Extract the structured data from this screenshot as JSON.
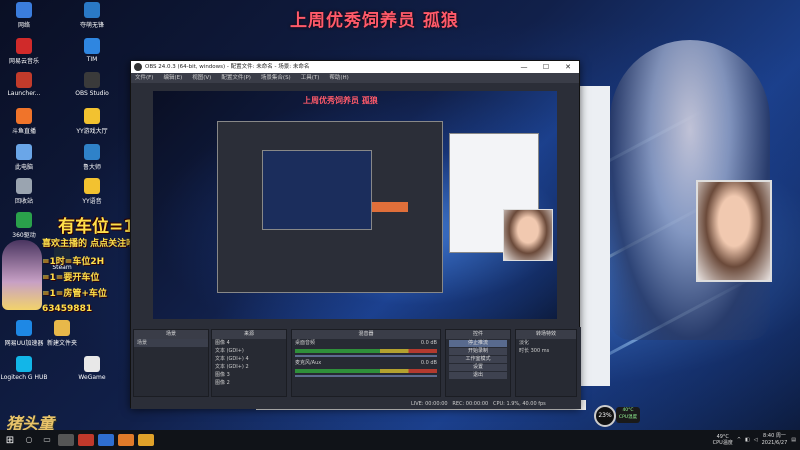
{
  "stream": {
    "title": "上周优秀饲养员 孤狼",
    "overlay_big": "有车位=1",
    "overlay_lines": [
      "喜欢主播的 点点关注哈",
      "=1时=车位2H",
      "=1=要开车位",
      "=1=房管+车位",
      "63459881"
    ]
  },
  "desktop_icons": [
    {
      "label": "网络",
      "color": "#3b7ddd"
    },
    {
      "label": "夺萌无锋",
      "color": "#2a79c6"
    },
    {
      "label": "网易云音乐",
      "color": "#d02a2a"
    },
    {
      "label": "TIM",
      "color": "#2f86e0"
    },
    {
      "label": "Launcher...",
      "color": "#c23b2b"
    },
    {
      "label": "OBS Studio",
      "color": "#3a3a3a"
    },
    {
      "label": "斗鱼直播",
      "color": "#f0742a"
    },
    {
      "label": "YY游戏大厅",
      "color": "#f2c230"
    },
    {
      "label": "此电脑",
      "color": "#6aa6e8"
    },
    {
      "label": "鲁大师",
      "color": "#2f82c9"
    },
    {
      "label": "回收站",
      "color": "#9aa4b0"
    },
    {
      "label": "YY语音",
      "color": "#f2c230"
    },
    {
      "label": "360驱动",
      "color": "#2aa14b"
    },
    {
      "label": "Steam",
      "color": "#1b2838"
    },
    {
      "label": "QQ音乐",
      "color": "#31c27c"
    },
    {
      "label": "网易UU加速器",
      "color": "#1e88e5"
    },
    {
      "label": "新建文件夹",
      "color": "#e8b84a"
    },
    {
      "label": "Logitech G HUB",
      "color": "#12b6e8"
    },
    {
      "label": "WeGame",
      "color": "#e8e8e8"
    }
  ],
  "obs": {
    "window_title": "OBS 24.0.3 (64-bit, windows) - 配置文件: 未命名 - 场景: 未命名",
    "menu": [
      "文件(F)",
      "编辑(E)",
      "视图(V)",
      "配置文件(P)",
      "场景集合(S)",
      "工具(T)",
      "帮助(H)"
    ],
    "preview_title": "上周优秀饲养员 孤狼",
    "docks": {
      "scenes": {
        "title": "场景",
        "items": [
          "场景"
        ]
      },
      "sources": {
        "title": "来源",
        "items": [
          "图像 4",
          "文本 (GDI+)",
          "文本 (GDI+) 4",
          "文本 (GDI+) 2",
          "图像 3",
          "图像 2"
        ]
      },
      "mixer": {
        "title": "混音器",
        "tracks": [
          {
            "name": "桌面音频",
            "db": "0.0 dB"
          },
          {
            "name": "麦克风/Aux",
            "db": "0.0 dB"
          }
        ]
      },
      "controls": {
        "title": "控件",
        "buttons": [
          "停止推流",
          "开始录制",
          "工作室模式",
          "设置",
          "退出"
        ]
      },
      "transitions": {
        "title": "转场特效",
        "type": "淡化",
        "duration_label": "时长",
        "duration": "300 ms"
      }
    },
    "status": {
      "live": "LIVE: 00:00:00",
      "rec": "REC: 00:00:00",
      "cpu": "CPU: 1.9%, 40.00 fps"
    }
  },
  "overlay": {
    "cpu_badge": "23%",
    "cpu_temp": "40°C",
    "cpu_temp_label": "CPU温度",
    "logo": "猪头童"
  },
  "taskbar": {
    "temp": "49°C",
    "temp_label": "CPU温度",
    "time": "8:40 周一",
    "date": "2021/6/27",
    "apps": [
      {
        "name": "obs",
        "color": "#555"
      },
      {
        "name": "netease-music",
        "color": "#c0392b"
      },
      {
        "name": "star-app",
        "color": "#2f6fd0"
      },
      {
        "name": "folder",
        "color": "#e07b2a"
      },
      {
        "name": "game",
        "color": "#e0a22a"
      }
    ]
  }
}
